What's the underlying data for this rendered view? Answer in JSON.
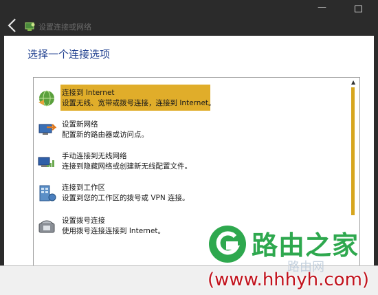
{
  "window": {
    "title": "设置连接或网络",
    "minimize_glyph": "—",
    "maximize_glyph": ""
  },
  "heading": "选择一个连接选项",
  "options": [
    {
      "title": "连接到 Internet",
      "desc": "设置无线、宽带或拨号连接，连接到 Internet。",
      "icon": "globe-icon",
      "selected": true
    },
    {
      "title": "设置新网络",
      "desc": "配置新的路由器或访问点。",
      "icon": "new-network-icon",
      "selected": false
    },
    {
      "title": "手动连接到无线网络",
      "desc": "连接到隐藏网络或创建新无线配置文件。",
      "icon": "wireless-network-icon",
      "selected": false
    },
    {
      "title": "连接到工作区",
      "desc": "设置到您的工作区的拨号或 VPN 连接。",
      "icon": "workplace-icon",
      "selected": false
    },
    {
      "title": "设置拨号连接",
      "desc": "使用拨号连接连接到 Internet。",
      "icon": "dialup-phone-icon",
      "selected": false
    }
  ],
  "colors": {
    "selection": "#e0ad2a",
    "heading": "#1f3f8f",
    "scroll_thumb": "#d7a61f"
  },
  "watermark": {
    "name": "路由之家",
    "sub": "路由网",
    "url": "(www.hhhyh.com)"
  }
}
